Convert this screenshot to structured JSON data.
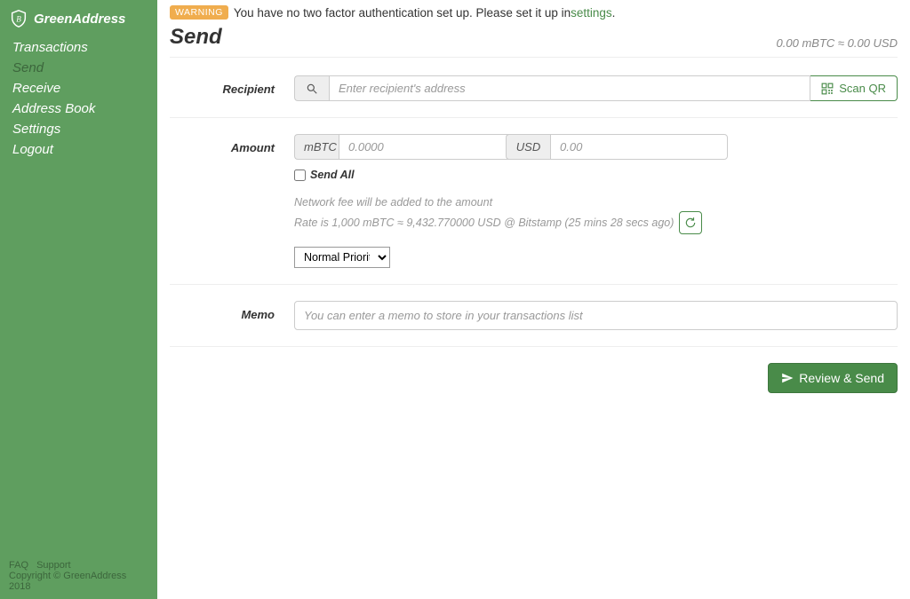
{
  "brand": {
    "name": "GreenAddress"
  },
  "sidebar": {
    "items": [
      {
        "label": "Transactions"
      },
      {
        "label": "Send"
      },
      {
        "label": "Receive"
      },
      {
        "label": "Address Book"
      },
      {
        "label": "Settings"
      },
      {
        "label": "Logout"
      }
    ],
    "active_index": 1,
    "footer": {
      "faq": "FAQ",
      "support": "Support",
      "copyright": "Copyright © GreenAddress 2018"
    }
  },
  "warning": {
    "badge": "WARNING",
    "text_prefix": "You have no two factor authentication set up. Please set it up in ",
    "link": "settings",
    "text_suffix": "."
  },
  "page": {
    "title": "Send",
    "balance": "0.00 mBTC ≈ 0.00 USD"
  },
  "recipient": {
    "label": "Recipient",
    "placeholder": "Enter recipient's address",
    "scan_qr": "Scan QR"
  },
  "amount": {
    "label": "Amount",
    "mbtc_label": "mBTC",
    "mbtc_placeholder": "0.0000",
    "usd_label": "USD",
    "usd_placeholder": "0.00",
    "send_all": "Send All",
    "fee_note": "Network fee will be added to the amount",
    "rate_text": "Rate is 1,000 mBTC ≈ 9,432.770000 USD @ Bitstamp (25 mins 28 secs ago)",
    "priority_selected": "Normal Priority"
  },
  "memo": {
    "label": "Memo",
    "placeholder": "You can enter a memo to store in your transactions list"
  },
  "actions": {
    "review_send": "Review & Send"
  }
}
